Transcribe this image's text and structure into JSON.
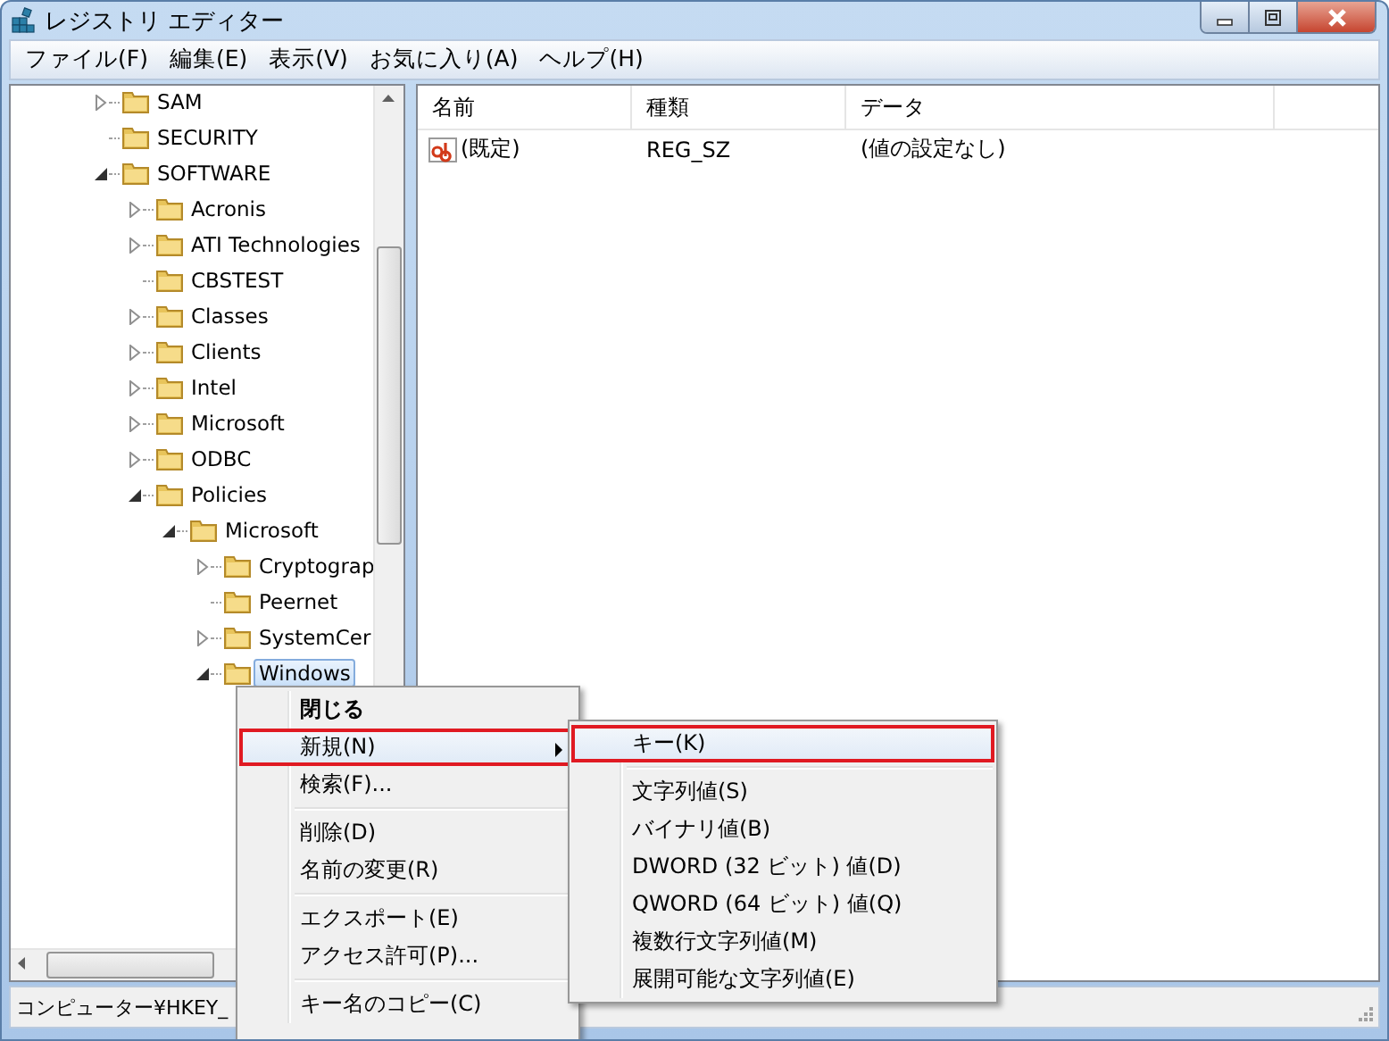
{
  "window": {
    "title": "レジストリ エディター"
  },
  "menubar": [
    "ファイル(F)",
    "編集(E)",
    "表示(V)",
    "お気に入り(A)",
    "ヘルプ(H)"
  ],
  "tree": [
    {
      "label": "SAM",
      "has_children": true,
      "expanded": false,
      "selected": false
    },
    {
      "label": "SECURITY",
      "has_children": false,
      "selected": false
    },
    {
      "label": "SOFTWARE",
      "has_children": true,
      "expanded": true,
      "selected": false,
      "children": [
        {
          "label": "Acronis",
          "has_children": true,
          "expanded": false,
          "selected": false
        },
        {
          "label": "ATI Technologies",
          "has_children": true,
          "expanded": false,
          "selected": false
        },
        {
          "label": "CBSTEST",
          "has_children": false,
          "selected": false
        },
        {
          "label": "Classes",
          "has_children": true,
          "expanded": false,
          "selected": false
        },
        {
          "label": "Clients",
          "has_children": true,
          "expanded": false,
          "selected": false
        },
        {
          "label": "Intel",
          "has_children": true,
          "expanded": false,
          "selected": false
        },
        {
          "label": "Microsoft",
          "has_children": true,
          "expanded": false,
          "selected": false
        },
        {
          "label": "ODBC",
          "has_children": true,
          "expanded": false,
          "selected": false
        },
        {
          "label": "Policies",
          "has_children": true,
          "expanded": true,
          "selected": false,
          "children": [
            {
              "label": "Microsoft",
              "has_children": true,
              "expanded": true,
              "selected": false,
              "children": [
                {
                  "label": "Cryptograp",
                  "has_children": true,
                  "expanded": false,
                  "selected": false
                },
                {
                  "label": "Peernet",
                  "has_children": false,
                  "selected": false
                },
                {
                  "label": "SystemCer",
                  "has_children": true,
                  "expanded": false,
                  "selected": false
                },
                {
                  "label": "Windows",
                  "has_children": true,
                  "expanded": true,
                  "selected": true
                }
              ]
            }
          ]
        }
      ]
    }
  ],
  "list": {
    "columns": [
      "名前",
      "種類",
      "データ"
    ],
    "rows": [
      {
        "name": "(既定)",
        "type": "REG_SZ",
        "data": "(値の設定なし)"
      }
    ]
  },
  "status_bar": "コンピューター¥HKEY_",
  "context_menu": [
    {
      "kind": "item",
      "label": "閉じる",
      "default": true,
      "submenu": false,
      "annotated": false
    },
    {
      "kind": "item",
      "label": "新規(N)",
      "default": false,
      "submenu": true,
      "annotated": true
    },
    {
      "kind": "item",
      "label": "検索(F)...",
      "default": false,
      "submenu": false,
      "annotated": false
    },
    {
      "kind": "separator"
    },
    {
      "kind": "item",
      "label": "削除(D)",
      "default": false,
      "submenu": false,
      "annotated": false
    },
    {
      "kind": "item",
      "label": "名前の変更(R)",
      "default": false,
      "submenu": false,
      "annotated": false
    },
    {
      "kind": "separator"
    },
    {
      "kind": "item",
      "label": "エクスポート(E)",
      "default": false,
      "submenu": false,
      "annotated": false
    },
    {
      "kind": "item",
      "label": "アクセス許可(P)...",
      "default": false,
      "submenu": false,
      "annotated": false
    },
    {
      "kind": "separator"
    },
    {
      "kind": "item",
      "label": "キー名のコピー(C)",
      "default": false,
      "submenu": false,
      "annotated": false
    }
  ],
  "submenu": [
    {
      "kind": "item",
      "label": "キー(K)",
      "default": false,
      "submenu": false,
      "annotated": true
    },
    {
      "kind": "separator"
    },
    {
      "kind": "item",
      "label": "文字列値(S)",
      "default": false,
      "submenu": false,
      "annotated": false
    },
    {
      "kind": "item",
      "label": "バイナリ値(B)",
      "default": false,
      "submenu": false,
      "annotated": false
    },
    {
      "kind": "item",
      "label": "DWORD (32 ビット) 値(D)",
      "default": false,
      "submenu": false,
      "annotated": false
    },
    {
      "kind": "item",
      "label": "QWORD (64 ビット) 値(Q)",
      "default": false,
      "submenu": false,
      "annotated": false
    },
    {
      "kind": "item",
      "label": "複数行文字列値(M)",
      "default": false,
      "submenu": false,
      "annotated": false
    },
    {
      "kind": "item",
      "label": "展開可能な文字列値(E)",
      "default": false,
      "submenu": false,
      "annotated": false
    }
  ]
}
